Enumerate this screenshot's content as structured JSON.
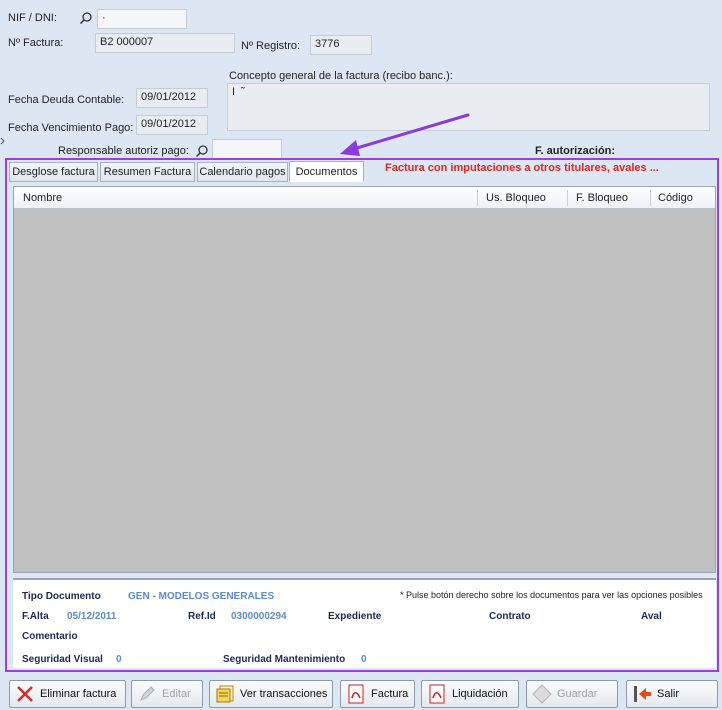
{
  "header": {
    "nif_label": "NIF / DNI:",
    "nif_value": "·",
    "factura_label": "Nº Factura:",
    "factura_value": "B2 000007",
    "registro_label": "Nº Registro:",
    "registro_value": "3776",
    "concepto_label": "Concepto general de la factura (recibo banc.):",
    "concepto_value": "I  ˜",
    "fecha_deuda_label": "Fecha Deuda Contable:",
    "fecha_deuda_value": "09/01/2012",
    "fecha_venc_label": "Fecha Vencimiento Pago:",
    "fecha_venc_value": "09/01/2012",
    "responsable_label": "Responsable autoriz pago:",
    "responsable_value": "",
    "f_autorizacion_label": "F. autorización:"
  },
  "tabs": [
    {
      "label": "Desglose factura"
    },
    {
      "label": "Resumen Factura"
    },
    {
      "label": "Calendario pagos"
    },
    {
      "label": "Documentos"
    }
  ],
  "warning_text": "Factura con imputaciones a otros titulares, avales ...",
  "grid": {
    "columns": [
      "Nombre",
      "Us. Bloqueo",
      "F. Bloqueo",
      "Código"
    ]
  },
  "details": {
    "tipo_documento_label": "Tipo Documento",
    "tipo_documento_value": "GEN - MODELOS GENERALES",
    "note": "* Pulse botón derecho sobre los documentos para ver las opciones posibles",
    "f_alta_label": "F.Alta",
    "f_alta_value": "05/12/2011",
    "ref_id_label": "Ref.Id",
    "ref_id_value": "0300000294",
    "expediente_label": "Expediente",
    "contrato_label": "Contrato",
    "aval_label": "Aval",
    "comentario_label": "Comentario",
    "seg_visual_label": "Seguridad Visual",
    "seg_visual_value": "0",
    "seg_mant_label": "Seguridad Mantenimiento",
    "seg_mant_value": "0"
  },
  "toolbar": {
    "eliminar": "Eliminar factura",
    "editar": "Editar",
    "ver_transacciones": "Ver transacciones",
    "factura": "Factura",
    "liquidacion": "Liquidación",
    "guardar": "Guardar",
    "salir": "Salir"
  },
  "colors": {
    "highlight": "#9b3fe0",
    "warning": "#e0271e",
    "detail_value": "#5b8ad0"
  }
}
